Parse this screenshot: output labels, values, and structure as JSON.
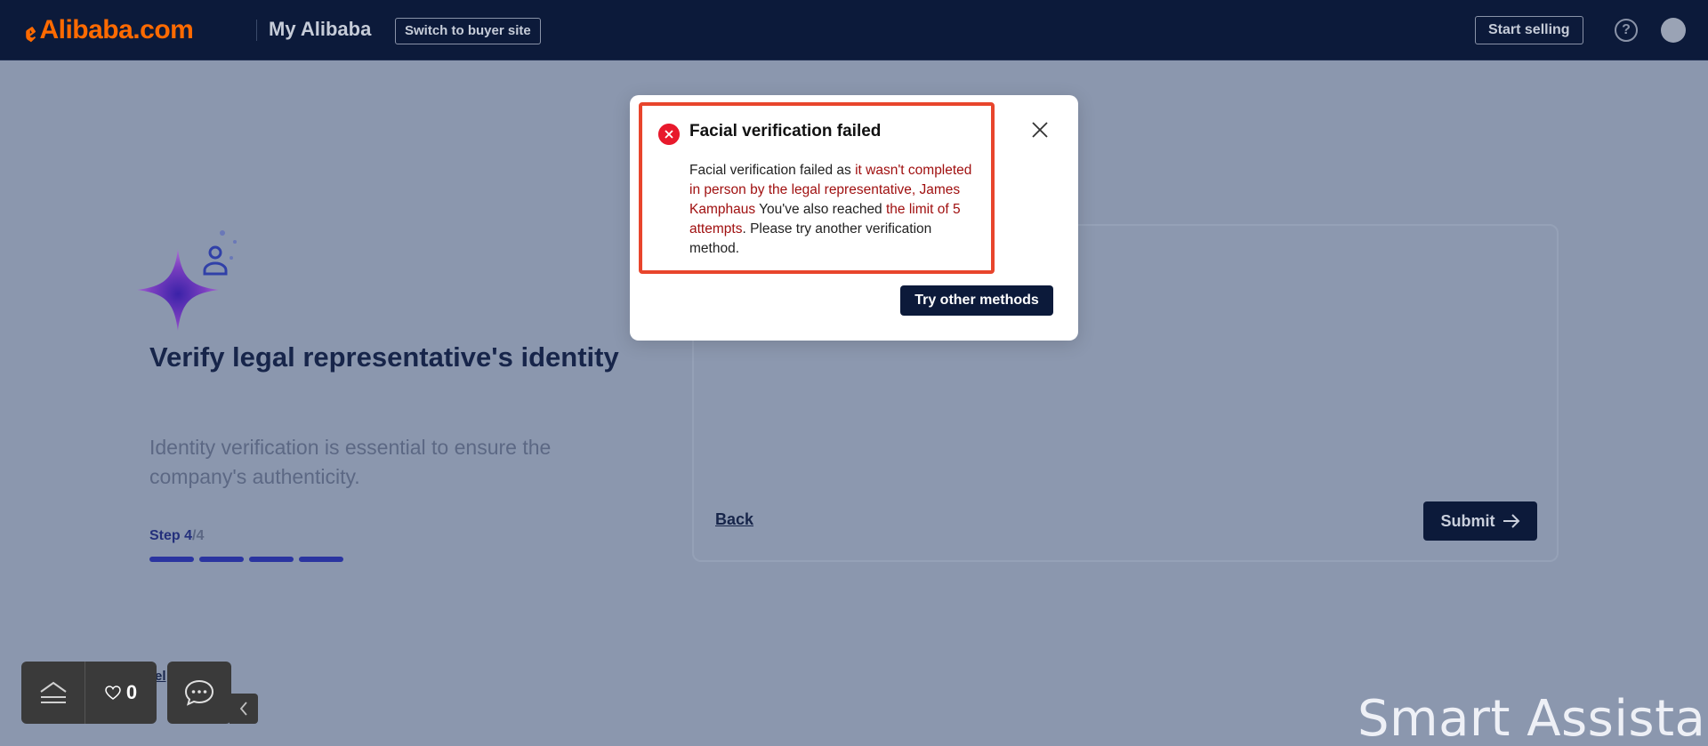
{
  "header": {
    "logo_text": "Alibaba.com",
    "section_title": "My Alibaba",
    "switch_label": "Switch to buyer site",
    "start_selling_label": "Start selling",
    "help_glyph": "?"
  },
  "page": {
    "title": "Verify legal representative's identity",
    "description": "Identity verification is essential to ensure the company's authenticity.",
    "step_label": "Step 4",
    "step_total": "/4",
    "progress": {
      "current": 4,
      "total": 4
    },
    "back_label": "Back",
    "submit_label": "Submit"
  },
  "floating_bar": {
    "favorites_count": "0"
  },
  "watermark": "Smart Assistant",
  "modal": {
    "title": "Facial verification failed",
    "body_parts": [
      {
        "text": "Facial verification failed as ",
        "style": "normal"
      },
      {
        "text": "it wasn't completed in person by the legal representative, James Kamphaus",
        "style": "red"
      },
      {
        "text": " You've also reached ",
        "style": "normal"
      },
      {
        "text": "the limit of 5 attempts",
        "style": "red"
      },
      {
        "text": ". Please try another verification method.",
        "style": "normal"
      }
    ],
    "primary_button_label": "Try other methods"
  },
  "colors": {
    "brand": "#ff6a00",
    "navy": "#0c1a3a",
    "error": "#e8192c",
    "highlight": "#e8452c",
    "error_text": "#a01010"
  },
  "icons": {
    "error": "error-circle-icon",
    "close": "close-icon",
    "help": "help-icon",
    "home": "home-icon",
    "heart": "heart-icon",
    "chat": "chat-icon",
    "collapse": "chevron-left-icon",
    "arrow": "arrow-right-icon"
  }
}
